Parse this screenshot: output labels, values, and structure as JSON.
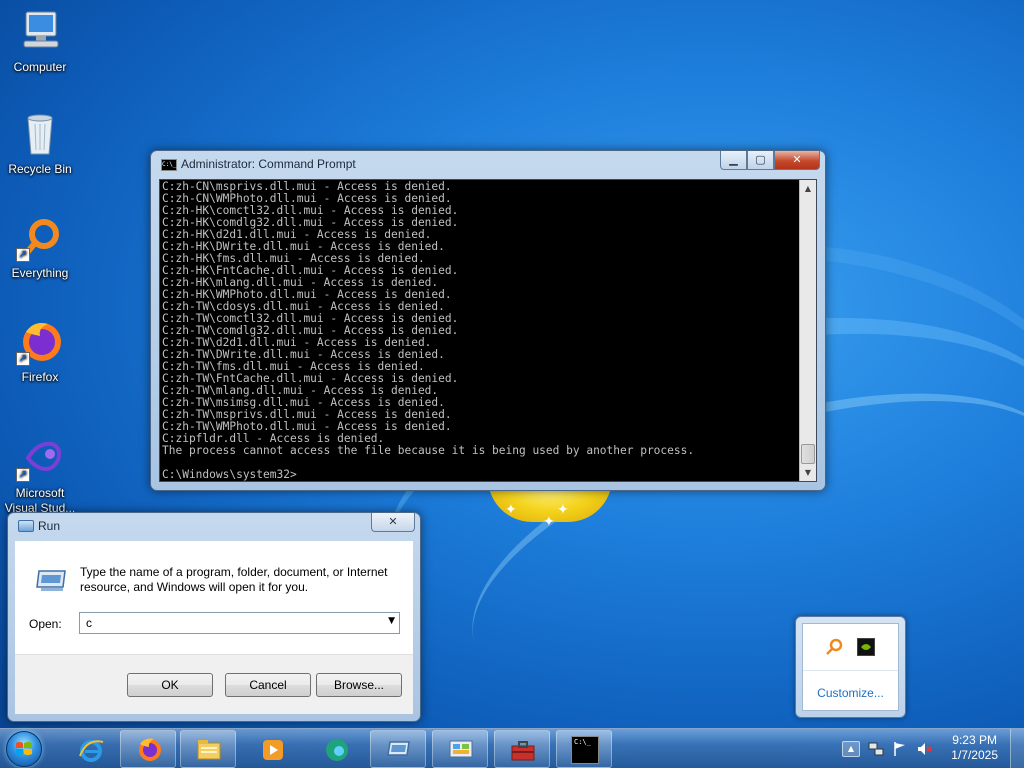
{
  "desktop": {
    "icons": [
      {
        "label": "Computer",
        "icon": "computer-icon"
      },
      {
        "label": "Recycle Bin",
        "icon": "recycle-bin-icon"
      },
      {
        "label": "Everything",
        "icon": "everything-icon"
      },
      {
        "label": "Firefox",
        "icon": "firefox-icon"
      },
      {
        "label": "Microsoft Visual Stud...",
        "icon": "visual-studio-icon"
      }
    ]
  },
  "cmd": {
    "title": "Administrator: Command Prompt",
    "title_icon": "C:\\_",
    "lines": [
      "C:zh-CN\\msprivs.dll.mui - Access is denied.",
      "C:zh-CN\\WMPhoto.dll.mui - Access is denied.",
      "C:zh-HK\\comctl32.dll.mui - Access is denied.",
      "C:zh-HK\\comdlg32.dll.mui - Access is denied.",
      "C:zh-HK\\d2d1.dll.mui - Access is denied.",
      "C:zh-HK\\DWrite.dll.mui - Access is denied.",
      "C:zh-HK\\fms.dll.mui - Access is denied.",
      "C:zh-HK\\FntCache.dll.mui - Access is denied.",
      "C:zh-HK\\mlang.dll.mui - Access is denied.",
      "C:zh-HK\\WMPhoto.dll.mui - Access is denied.",
      "C:zh-TW\\cdosys.dll.mui - Access is denied.",
      "C:zh-TW\\comctl32.dll.mui - Access is denied.",
      "C:zh-TW\\comdlg32.dll.mui - Access is denied.",
      "C:zh-TW\\d2d1.dll.mui - Access is denied.",
      "C:zh-TW\\DWrite.dll.mui - Access is denied.",
      "C:zh-TW\\fms.dll.mui - Access is denied.",
      "C:zh-TW\\FntCache.dll.mui - Access is denied.",
      "C:zh-TW\\mlang.dll.mui - Access is denied.",
      "C:zh-TW\\msimsg.dll.mui - Access is denied.",
      "C:zh-TW\\msprivs.dll.mui - Access is denied.",
      "C:zh-TW\\WMPhoto.dll.mui - Access is denied.",
      "C:zipfldr.dll - Access is denied.",
      "The process cannot access the file because it is being used by another process.",
      "",
      "C:\\Windows\\system32>"
    ]
  },
  "run": {
    "title": "Run",
    "description": "Type the name of a program, folder, document, or Internet resource, and Windows will open it for you.",
    "open_label": "Open:",
    "open_value": "c",
    "ok_label": "OK",
    "cancel_label": "Cancel",
    "browse_label": "Browse..."
  },
  "tray_popup": {
    "customize_label": "Customize..."
  },
  "taskbar": {
    "time": "9:23 PM",
    "date": "1/7/2025",
    "buttons": [
      "internet-explorer-icon",
      "firefox-icon",
      "file-explorer-icon",
      "media-player-icon",
      "edge-icon",
      "run-icon",
      "control-panel-icon",
      "toolbox-icon",
      "command-prompt-icon"
    ]
  },
  "colors": {
    "cmd_text": "#c0c0c0",
    "link": "#1f6fc4",
    "desktop": "#1e7fdc"
  }
}
